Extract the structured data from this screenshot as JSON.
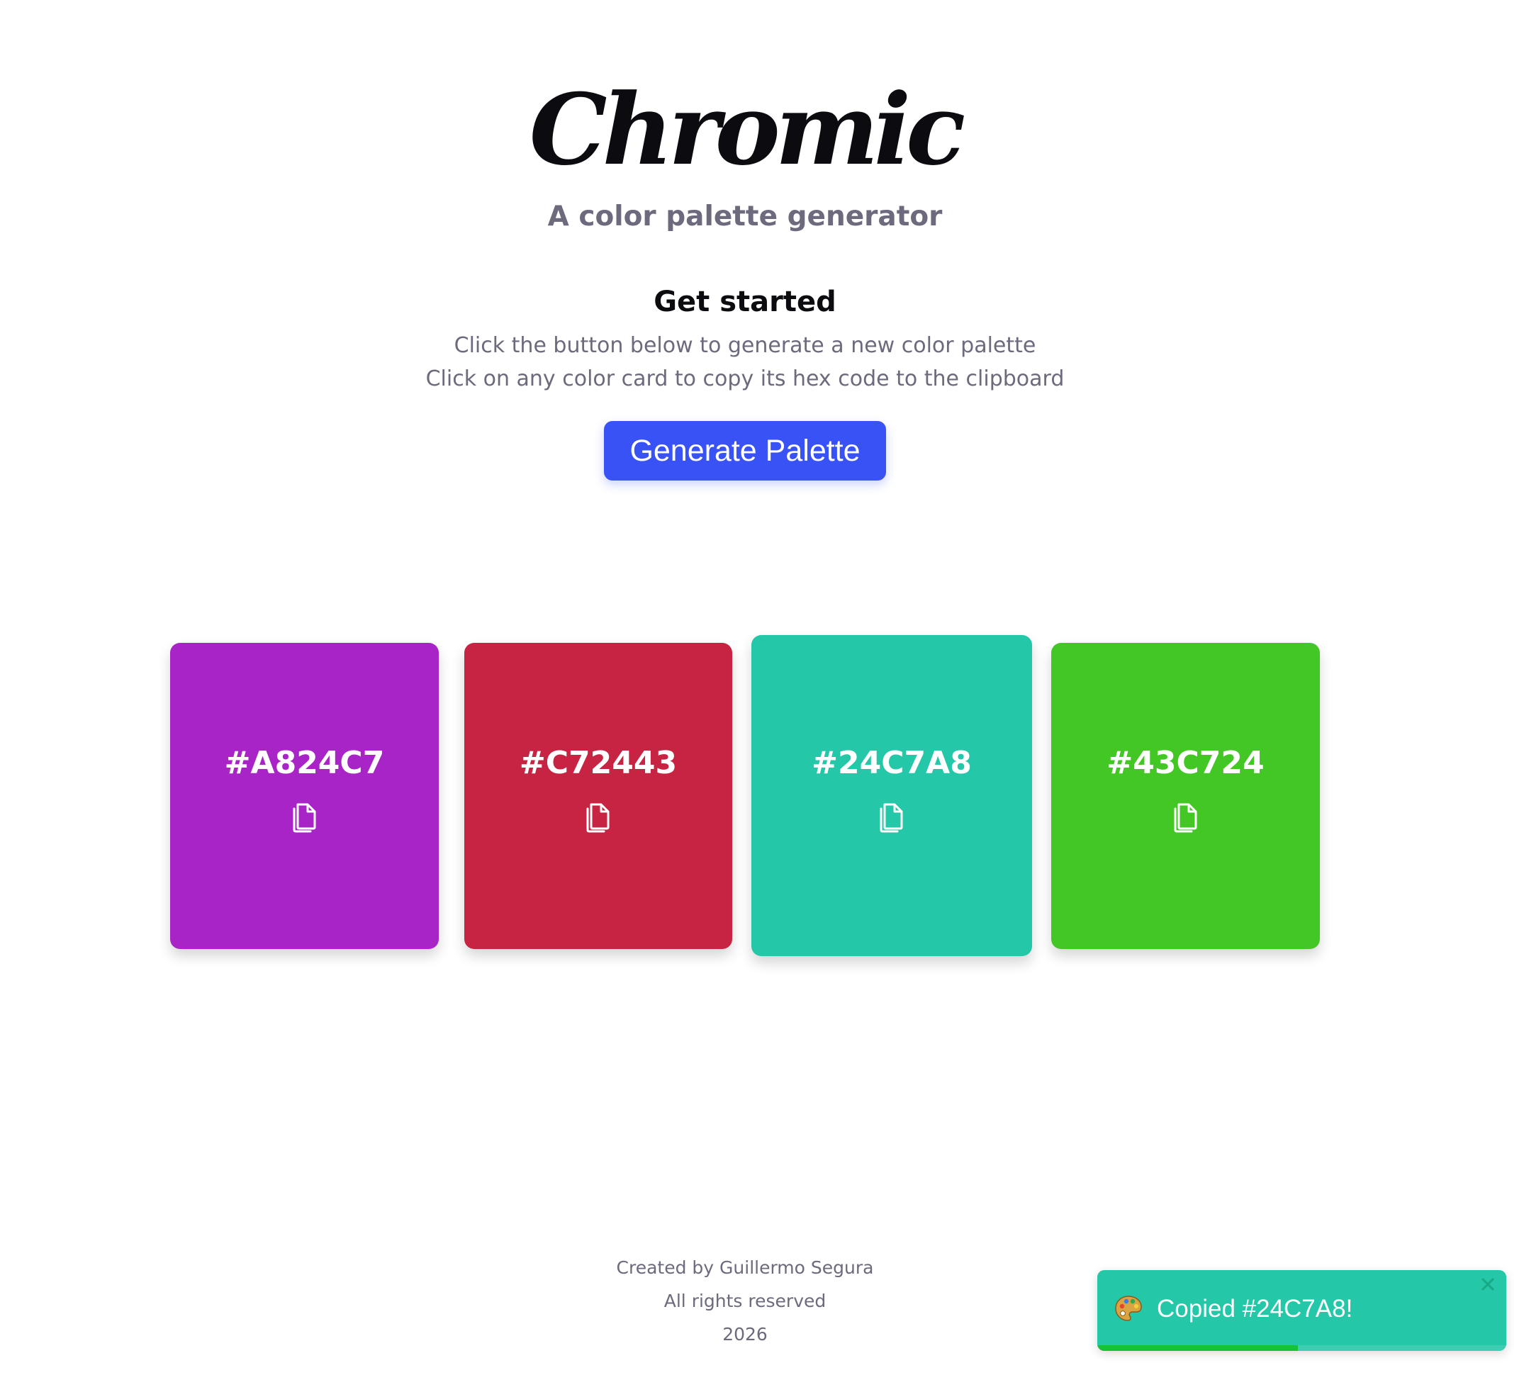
{
  "header": {
    "title": "Chromic",
    "subtitle": "A color palette generator"
  },
  "intro": {
    "heading": "Get started",
    "lines": [
      "Click the button below to generate a new color palette",
      "Click on any color card to copy its hex code to the clipboard"
    ]
  },
  "generate_button": {
    "label": "Generate Palette",
    "color": "#3852F5"
  },
  "palette": [
    {
      "hex": "#A824C7",
      "color": "#A824C7",
      "icon": "copy-icon",
      "hovered": false
    },
    {
      "hex": "#C72443",
      "color": "#C72443",
      "icon": "copy-icon",
      "hovered": false
    },
    {
      "hex": "#24C7A8",
      "color": "#24C7A8",
      "icon": "copy-icon",
      "hovered": true
    },
    {
      "hex": "#43C724",
      "color": "#43C724",
      "icon": "copy-icon",
      "hovered": false
    }
  ],
  "footer": {
    "credit": "Created by Guillermo Segura",
    "rights": "All rights reserved",
    "year": "2026"
  },
  "toast": {
    "emoji_icon": "palette-icon",
    "message": "Copied #24C7A8!",
    "background": "#24C7A8",
    "progress_color": "#16C23A",
    "progress": 0.49,
    "close_icon": "close-icon"
  }
}
